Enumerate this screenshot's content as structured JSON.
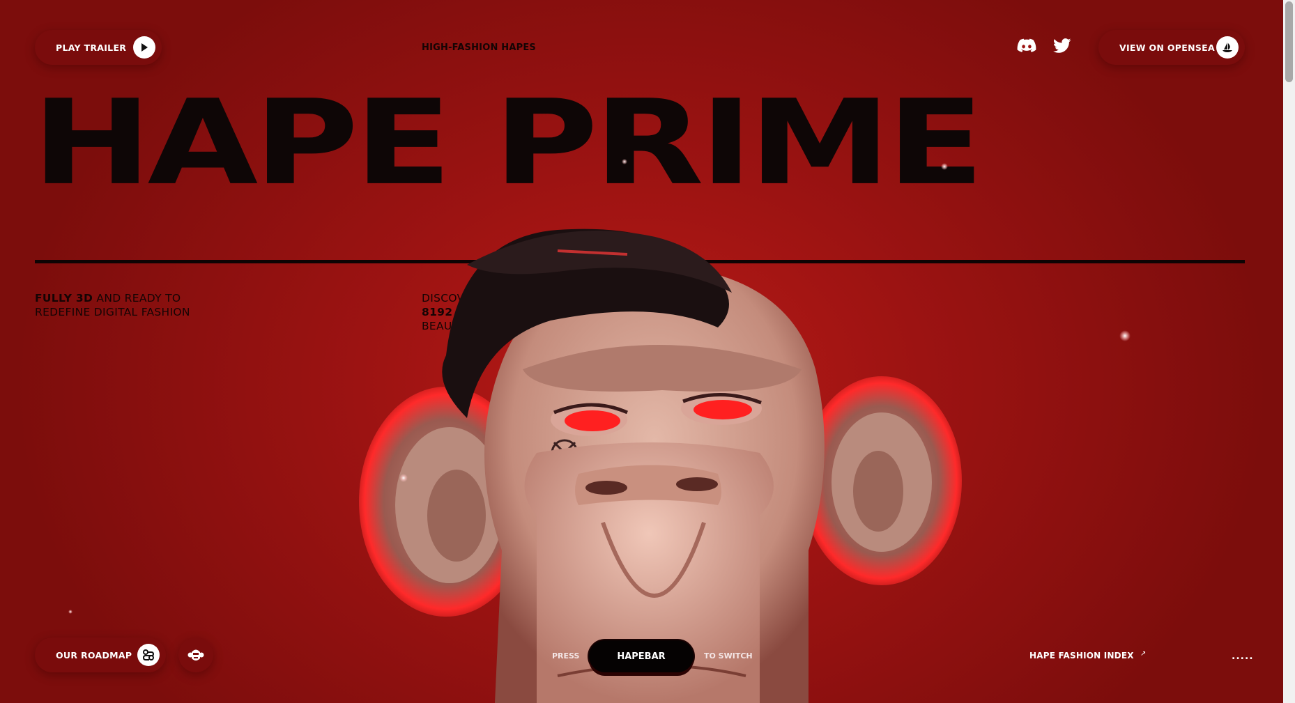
{
  "header": {
    "play_trailer_label": "PLAY TRAILER",
    "tagline": "HIGH-FASHION HAPES",
    "opensea_label": "VIEW ON OPENSEA",
    "social_icons": [
      "discord-icon",
      "twitter-icon"
    ]
  },
  "hero": {
    "title": "HAPE PRIME"
  },
  "blurbs": {
    "left_bold": "FULLY 3D",
    "left_rest": "AND READY TO REDEFINE DIGITAL FASHION",
    "mid_top": "DISCOVER",
    "mid_bold": "8192 UNIQUE",
    "mid_bottom": "BEAUTIFUL HAPES"
  },
  "footer": {
    "roadmap_label": "OUR ROADMAP",
    "press_label": "PRESS",
    "hapebar_label": "HAPEBAR",
    "switch_label": "TO SWITCH",
    "fashion_index_label": "HAPE FASHION INDEX",
    "fashion_index_arrow": "↗",
    "dots": "....."
  },
  "theme": {
    "background": "#a01414",
    "text_dark": "#0e0606",
    "pill_bg": "#7a0c0c",
    "accent_white": "#ffffff"
  }
}
